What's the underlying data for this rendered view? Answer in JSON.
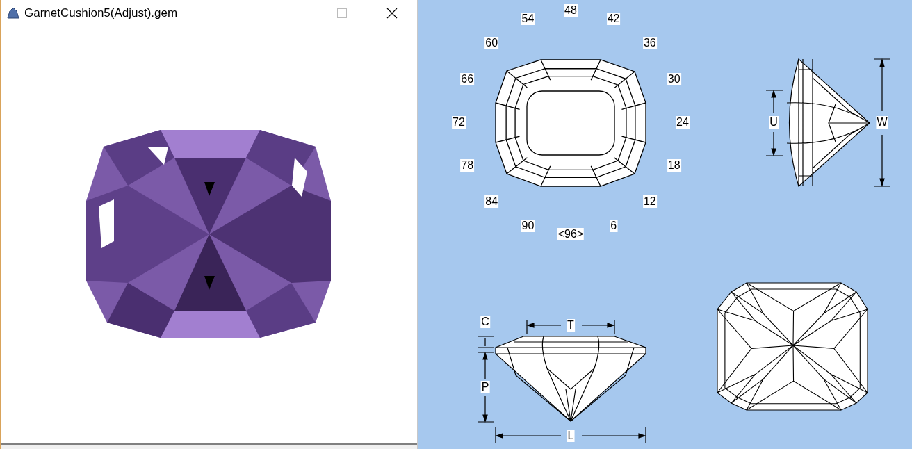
{
  "window": {
    "title": "GarnetCushion5(Adjust).gem"
  },
  "diagram": {
    "index_labels": [
      "48",
      "42",
      "36",
      "30",
      "24",
      "18",
      "12",
      "6",
      "<96>",
      "90",
      "84",
      "78",
      "72",
      "66",
      "60",
      "54"
    ],
    "end_view": {
      "labels": [
        "U",
        "W"
      ]
    },
    "side_view": {
      "labels": [
        "C",
        "T",
        "P",
        "L"
      ]
    }
  }
}
